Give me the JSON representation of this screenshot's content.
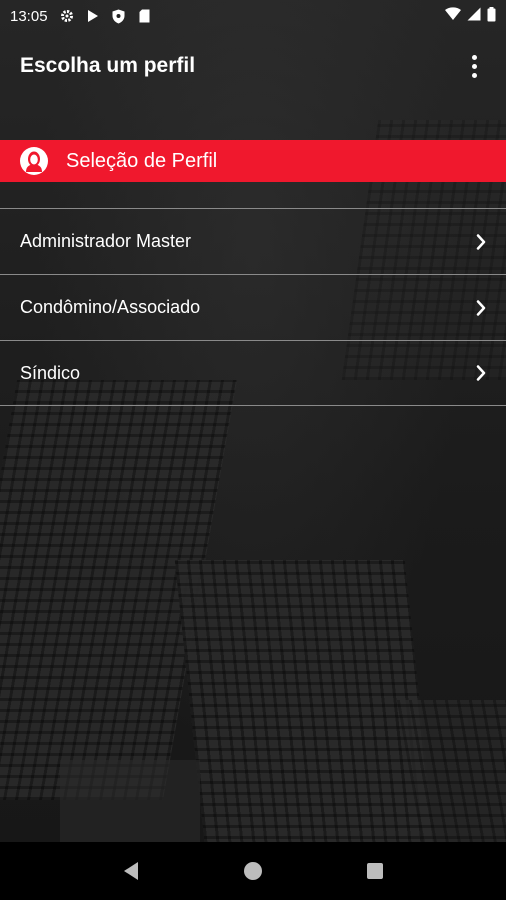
{
  "status_bar": {
    "time": "13:05",
    "left_icons": [
      "settings-icon",
      "play-store-icon",
      "shield-icon",
      "sd-card-icon"
    ],
    "right_icons": [
      "wifi-icon",
      "signal-icon",
      "battery-icon"
    ]
  },
  "app_bar": {
    "title": "Escolha um perfil",
    "menu_icon": "more-vert-icon"
  },
  "section": {
    "label": "Seleção de Perfil",
    "icon": "person-icon",
    "color": "#f0182d"
  },
  "profiles": [
    {
      "label": "Administrador Master"
    },
    {
      "label": "Condômino/Associado"
    },
    {
      "label": "Síndico"
    }
  ],
  "nav_bar": {
    "buttons": [
      "back-icon",
      "home-icon",
      "recents-icon"
    ]
  }
}
